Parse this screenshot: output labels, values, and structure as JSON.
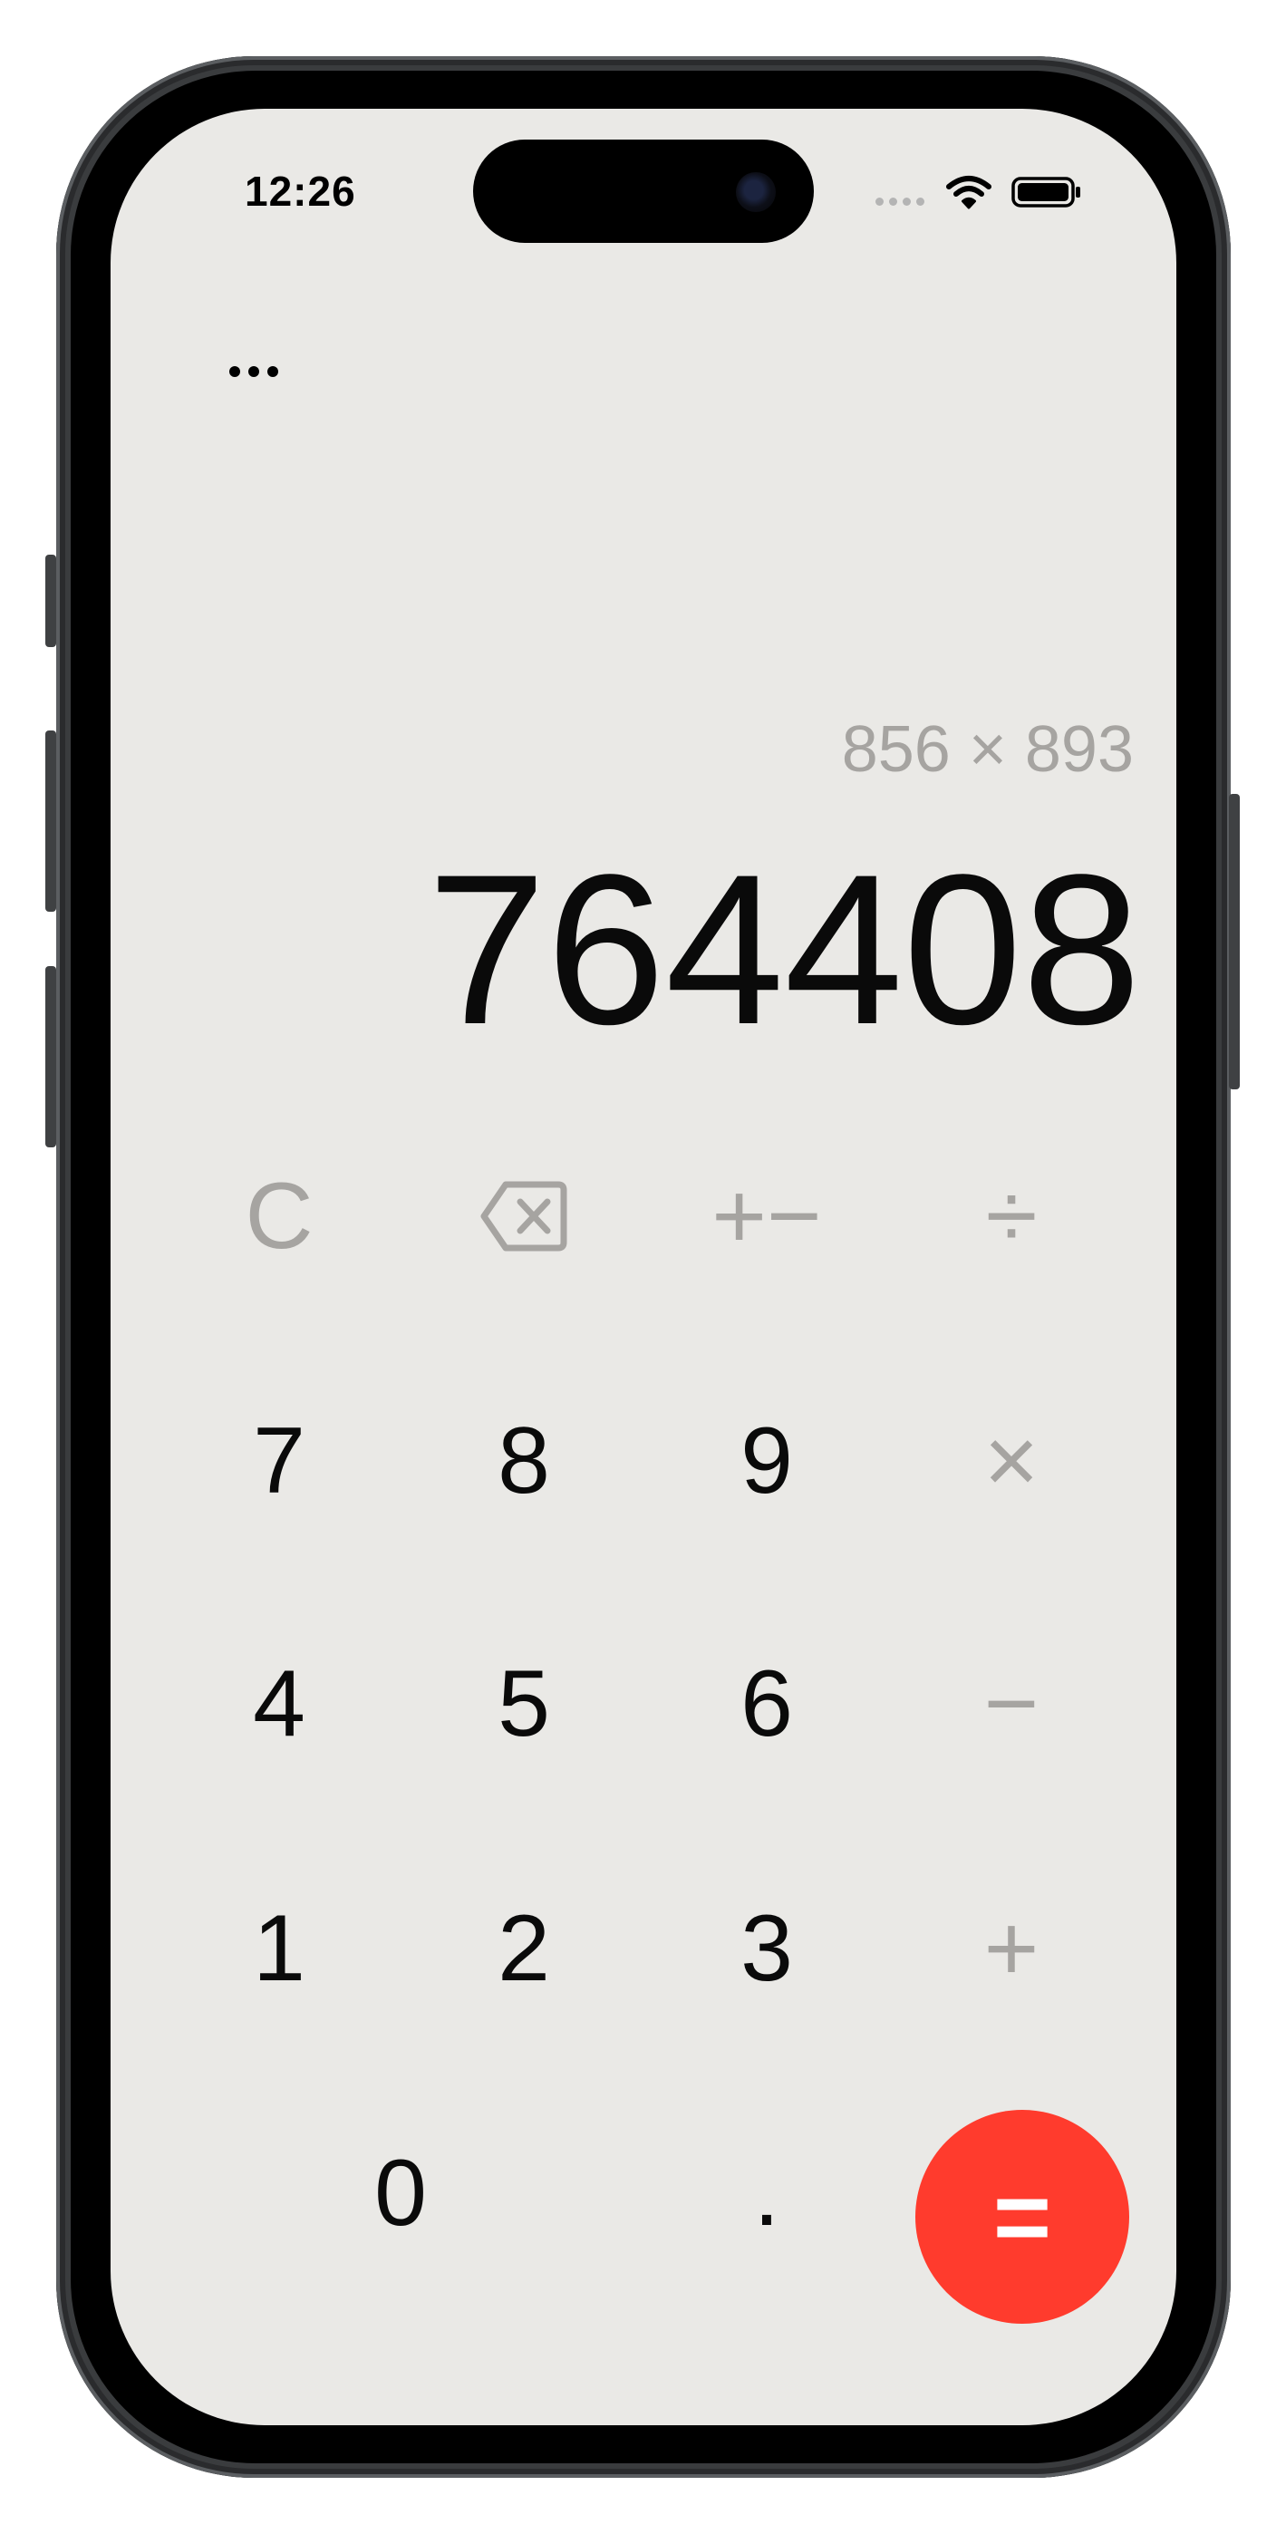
{
  "status_bar": {
    "time": "12:26"
  },
  "toolbar": {
    "more_icon": "ellipsis-icon"
  },
  "display": {
    "expression": "856 × 893",
    "result": "764408"
  },
  "keypad": {
    "clear": "C",
    "backspace_icon": "backspace-icon",
    "sign": "+−",
    "divide": "÷",
    "seven": "7",
    "eight": "8",
    "nine": "9",
    "multiply": "×",
    "four": "4",
    "five": "5",
    "six": "6",
    "subtract": "−",
    "one": "1",
    "two": "2",
    "three": "3",
    "add": "+",
    "zero": "0",
    "decimal": ".",
    "equals": "="
  },
  "colors": {
    "screen_background": "#eae9e6",
    "text_primary": "#0a0a0a",
    "text_secondary": "#a6a4a1",
    "equals_button": "#ff3b2d"
  }
}
